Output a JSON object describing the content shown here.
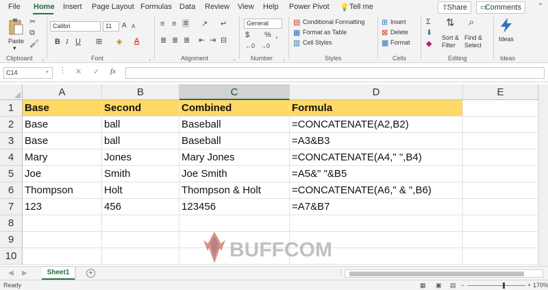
{
  "menu": {
    "items": [
      "File",
      "Home",
      "Insert",
      "Page Layout",
      "Formulas",
      "Data",
      "Review",
      "View",
      "Help",
      "Power Pivot",
      "Tell me"
    ],
    "share": "Share",
    "comments": "Comments"
  },
  "ribbon": {
    "paste": "Paste",
    "font_name": "Calibri",
    "font_size": "11",
    "number_format": "General",
    "conditional_formatting": "Conditional Formatting",
    "format_as_table": "Format as Table",
    "cell_styles": "Cell Styles",
    "insert": "Insert",
    "delete": "Delete",
    "format": "Format",
    "sort_filter": "Sort & Filter",
    "find_select": "Find & Select",
    "ideas": "Ideas",
    "groups": {
      "clipboard": "Clipboard",
      "font": "Font",
      "alignment": "Alignment",
      "number": "Number",
      "styles": "Styles",
      "cells": "Cells",
      "editing": "Editing",
      "ideas": "Ideas"
    }
  },
  "formula_bar": {
    "name_box": "C14",
    "fx": "fx",
    "value": ""
  },
  "columns": [
    "A",
    "B",
    "C",
    "D",
    "E"
  ],
  "rows": [
    "1",
    "2",
    "3",
    "4",
    "5",
    "6",
    "7",
    "8",
    "9",
    "10"
  ],
  "cells": [
    [
      "Base",
      "Second",
      "Combined",
      "Formula"
    ],
    [
      "Base",
      "ball",
      "Baseball",
      "=CONCATENATE(A2,B2)"
    ],
    [
      "Base",
      "ball",
      "Baseball",
      "=A3&B3"
    ],
    [
      "Mary",
      "Jones",
      "Mary Jones",
      "=CONCATENATE(A4,\" \",B4)"
    ],
    [
      "Joe",
      "Smith",
      "Joe Smith",
      "=A5&\" \"&B5"
    ],
    [
      "Thompson",
      "Holt",
      "Thompson & Holt",
      "=CONCATENATE(A6,\" & \",B6)"
    ],
    [
      "123",
      "456",
      "123456",
      "=A7&B7"
    ]
  ],
  "watermark": "BUFFCOM",
  "sheet_tab": "Sheet1",
  "status": {
    "ready": "Ready",
    "zoom": "170%"
  },
  "colors": {
    "accent": "#217346",
    "header_fill": "#ffd966"
  }
}
